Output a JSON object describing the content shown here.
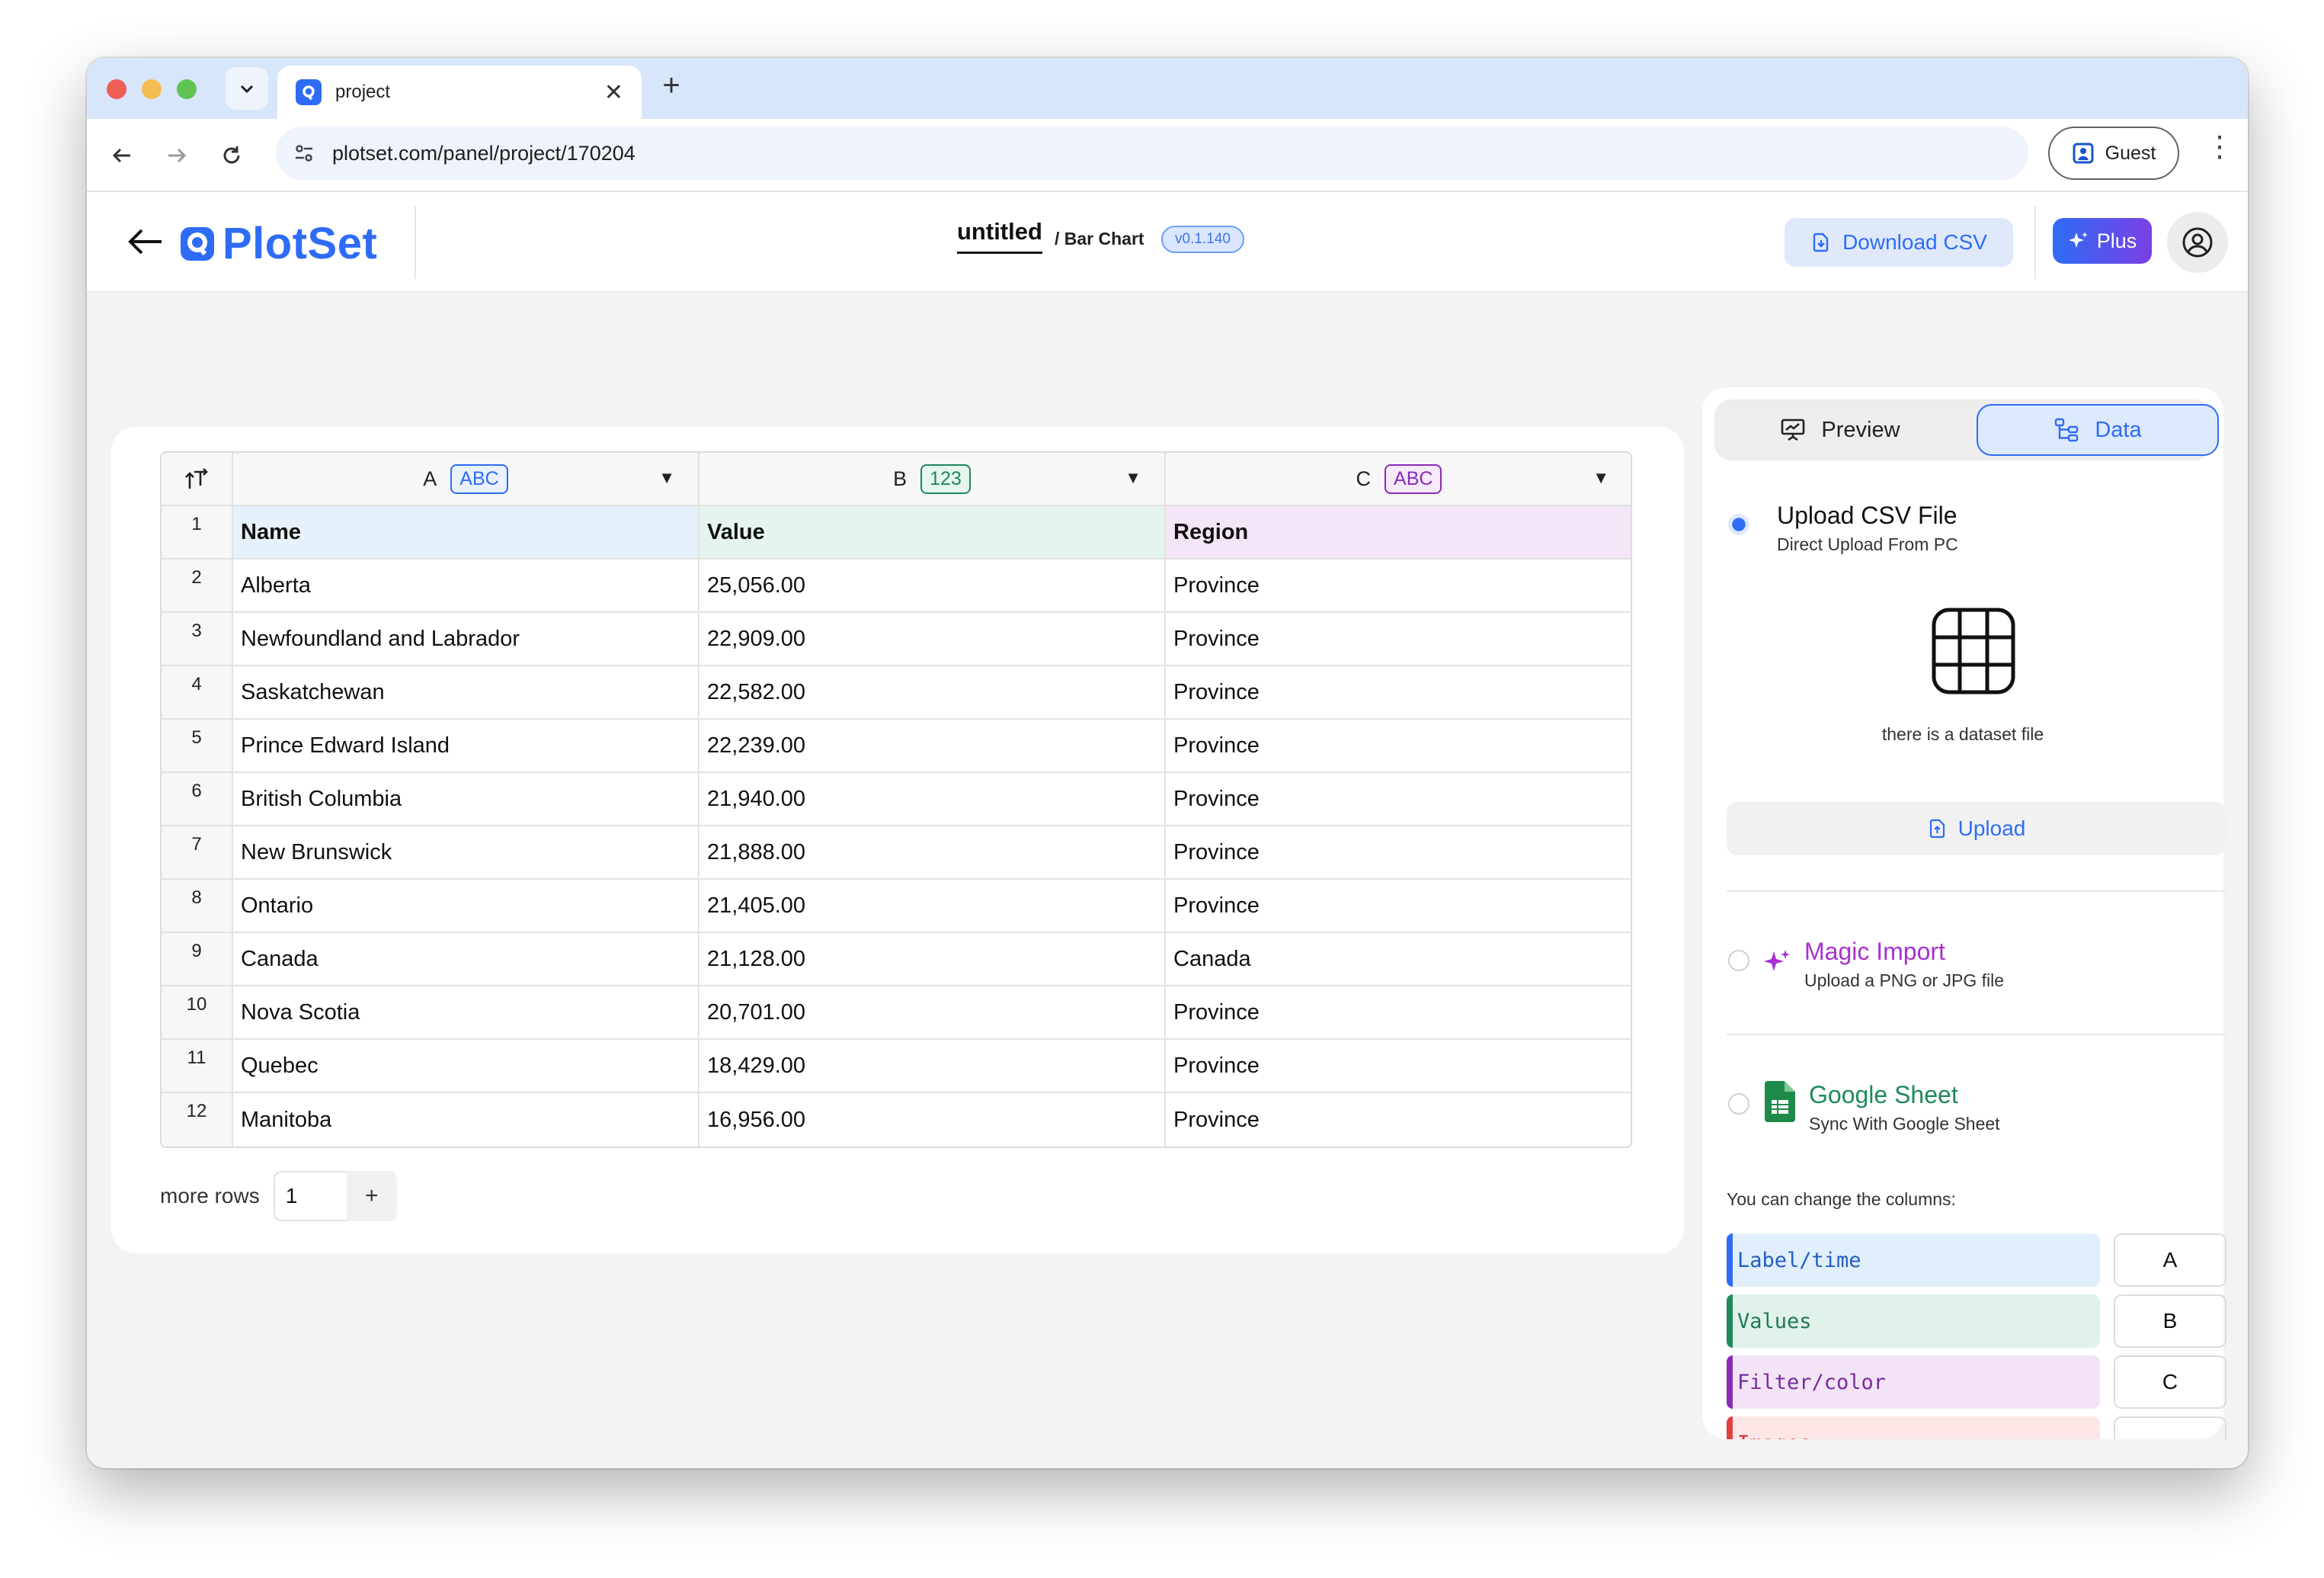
{
  "browser": {
    "tab_title": "project",
    "url": "plotset.com/panel/project/170204",
    "guest_label": "Guest"
  },
  "header": {
    "logo_text": "PlotSet",
    "project_title": "untitled",
    "chart_type": "/ Bar Chart",
    "version": "v0.1.140",
    "download_label": "Download CSV",
    "plus_label": "Plus"
  },
  "sheet": {
    "columns": [
      {
        "letter": "A",
        "type": "ABC"
      },
      {
        "letter": "B",
        "type": "123"
      },
      {
        "letter": "C",
        "type": "ABC"
      }
    ],
    "rows": [
      {
        "num": "1",
        "a": "Name",
        "b": "Value",
        "c": "Region"
      },
      {
        "num": "2",
        "a": "Alberta",
        "b": "25,056.00",
        "c": "Province"
      },
      {
        "num": "3",
        "a": "Newfoundland and Labrador",
        "b": "22,909.00",
        "c": "Province"
      },
      {
        "num": "4",
        "a": "Saskatchewan",
        "b": "22,582.00",
        "c": "Province"
      },
      {
        "num": "5",
        "a": "Prince Edward Island",
        "b": "22,239.00",
        "c": "Province"
      },
      {
        "num": "6",
        "a": "British Columbia",
        "b": "21,940.00",
        "c": "Province"
      },
      {
        "num": "7",
        "a": "New Brunswick",
        "b": "21,888.00",
        "c": "Province"
      },
      {
        "num": "8",
        "a": "Ontario",
        "b": "21,405.00",
        "c": "Province"
      },
      {
        "num": "9",
        "a": "Canada",
        "b": "21,128.00",
        "c": "Canada"
      },
      {
        "num": "10",
        "a": "Nova Scotia",
        "b": "20,701.00",
        "c": "Province"
      },
      {
        "num": "11",
        "a": "Quebec",
        "b": "18,429.00",
        "c": "Province"
      },
      {
        "num": "12",
        "a": "Manitoba",
        "b": "16,956.00",
        "c": "Province"
      }
    ],
    "more_rows_label": "more rows",
    "more_rows_value": "1",
    "more_rows_plus": "+"
  },
  "panel": {
    "tab_preview": "Preview",
    "tab_data": "Data",
    "upload_csv_title": "Upload CSV File",
    "upload_csv_sub": "Direct Upload From PC",
    "dataset_label": "there is a dataset file",
    "upload_button": "Upload",
    "magic_title": "Magic Import",
    "magic_sub": "Upload a PNG or JPG file",
    "gsheet_title": "Google Sheet",
    "gsheet_sub": "Sync With Google Sheet",
    "columns_caption": "You can change the columns:",
    "mappings": [
      {
        "label": "Label/time",
        "value": "A"
      },
      {
        "label": "Values",
        "value": "B"
      },
      {
        "label": "Filter/color",
        "value": "C"
      },
      {
        "label": "Images",
        "value": ""
      }
    ]
  },
  "colors": {
    "brand": "#2e6cf6",
    "label_col": "#e6f1fc",
    "value_col": "#e5f4ef",
    "region_col": "#f3e6f6"
  }
}
